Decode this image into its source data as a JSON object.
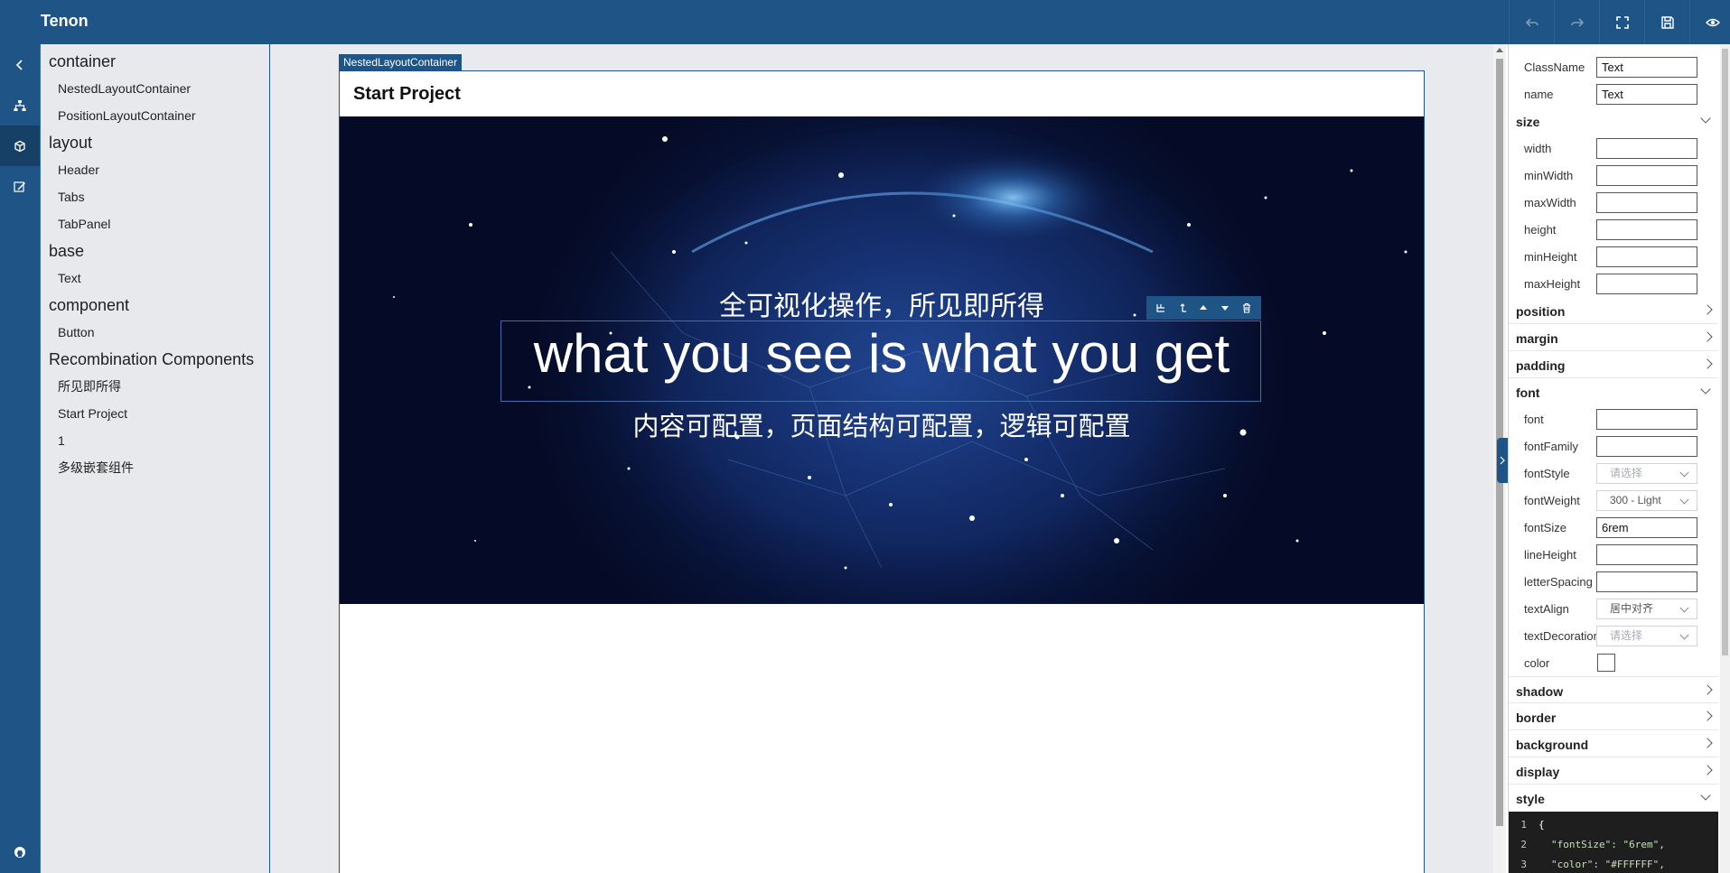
{
  "app": {
    "title": "Tenon"
  },
  "toolbar": {
    "icons": [
      "undo-icon",
      "redo-icon",
      "fullscreen-icon",
      "save-icon",
      "preview-icon"
    ]
  },
  "rail": {
    "icons": [
      "collapse-left-icon",
      "tree-structure-icon",
      "components-box-icon",
      "edit-icon",
      "github-icon"
    ]
  },
  "tree": {
    "groups": [
      {
        "label": "container",
        "items": [
          "NestedLayoutContainer",
          "PositionLayoutContainer"
        ]
      },
      {
        "label": "layout",
        "items": [
          "Header",
          "Tabs",
          "TabPanel"
        ]
      },
      {
        "label": "base",
        "items": [
          "Text"
        ]
      },
      {
        "label": "component",
        "items": [
          "Button"
        ]
      },
      {
        "label": "Recombination Components",
        "items": [
          "所见即所得",
          "Start Project",
          "1",
          "多级嵌套组件"
        ]
      }
    ]
  },
  "canvas": {
    "container_tag": "NestedLayoutContainer",
    "page_title": "Start Project",
    "hero": {
      "line1": "全可视化操作，所见即所得",
      "main": "what you see is what you get",
      "line3": "内容可配置，页面结构可配置，逻辑可配置"
    },
    "selection_toolbar": [
      "select-parent-icon",
      "move-out-icon",
      "move-up-icon",
      "move-down-icon",
      "delete-icon"
    ]
  },
  "panel": {
    "classname": {
      "label": "ClassName",
      "value": "Text"
    },
    "name": {
      "label": "name",
      "value": "Text"
    },
    "size": {
      "title": "size",
      "fields": [
        {
          "label": "width",
          "value": ""
        },
        {
          "label": "minWidth",
          "value": ""
        },
        {
          "label": "maxWidth",
          "value": ""
        },
        {
          "label": "height",
          "value": ""
        },
        {
          "label": "minHeight",
          "value": ""
        },
        {
          "label": "maxHeight",
          "value": ""
        }
      ]
    },
    "position": "position",
    "margin": "margin",
    "padding": "padding",
    "font": {
      "title": "font",
      "font": {
        "label": "font",
        "value": ""
      },
      "fontFamily": {
        "label": "fontFamily",
        "value": ""
      },
      "fontStyle": {
        "label": "fontStyle",
        "placeholder": "请选择"
      },
      "fontWeight": {
        "label": "fontWeight",
        "value": "300 - Light"
      },
      "fontSize": {
        "label": "fontSize",
        "value": "6rem"
      },
      "lineHeight": {
        "label": "lineHeight",
        "value": ""
      },
      "letterSpacing": {
        "label": "letterSpacing",
        "value": ""
      },
      "textAlign": {
        "label": "textAlign",
        "value": "居中对齐"
      },
      "textDecoration": {
        "label": "textDecoration",
        "placeholder": "请选择"
      },
      "color": {
        "label": "color",
        "value": "#FFFFFF"
      }
    },
    "shadow": "shadow",
    "border": "border",
    "background": "background",
    "display": "display",
    "style": {
      "title": "style",
      "lines": [
        {
          "n": "1",
          "text": "{"
        },
        {
          "n": "2",
          "text": "\"fontSize\": \"6rem\","
        },
        {
          "n": "3",
          "text": "\"color\": \"#FFFFFF\","
        }
      ]
    }
  },
  "colors": {
    "brand": "#1f5586",
    "tree_bg": "#e8e9ec",
    "canvas_bg": "#e9eaed"
  }
}
